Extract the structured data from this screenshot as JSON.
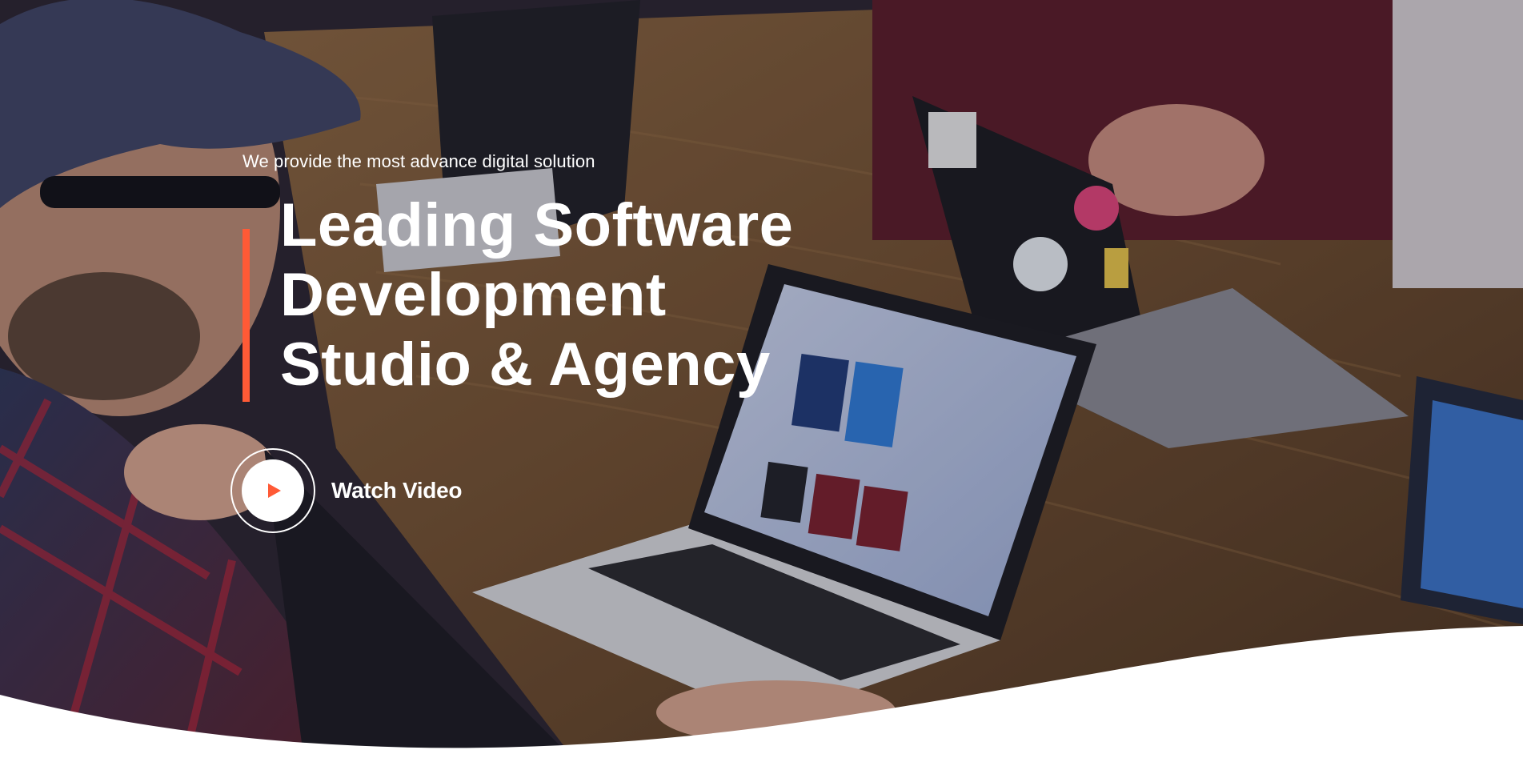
{
  "hero": {
    "tagline": "We provide the most advance digital solution",
    "title_lines": [
      "Leading Software",
      "Development",
      "Studio & Agency"
    ],
    "video": {
      "label": "Watch Video",
      "icon": "play-icon"
    },
    "background_image": "photo of a team meeting with laptops on a wooden table",
    "colors": {
      "accent": "#ff5a36",
      "text": "#ffffff",
      "wave": "#ffffff"
    }
  }
}
